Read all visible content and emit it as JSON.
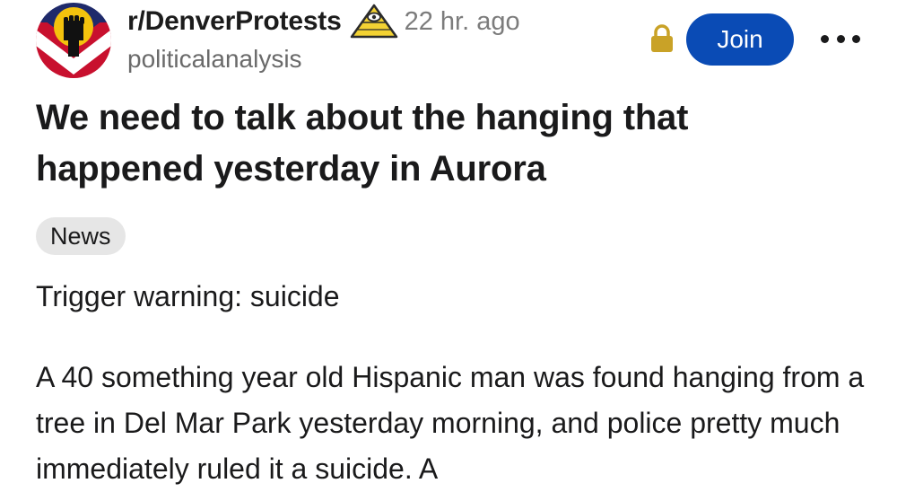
{
  "header": {
    "subreddit": "r/DenverProtests",
    "time_ago": "22 hr. ago",
    "username": "politicalanalysis",
    "join_label": "Join",
    "icons": {
      "avatar": "raised-fist-avatar",
      "award": "illuminati-pyramid-award-icon",
      "lock": "lock-icon",
      "more": "more-options-icon"
    }
  },
  "post": {
    "title": "We need to talk about the hanging that happened yesterday in Aurora",
    "flair": "News",
    "trigger_warning": "Trigger warning: suicide",
    "body": "A 40 something year old Hispanic man was found hanging from a tree in Del Mar Park yesterday morning, and police pretty much immediately ruled it a suicide. A"
  },
  "colors": {
    "join_bg": "#0a4bb5",
    "flair_bg": "#e6e6e6",
    "meta_gray": "#7c7c7c",
    "lock_gold": "#c9a227",
    "avatar_red": "#c8102e",
    "avatar_navy": "#1f2a6b",
    "avatar_yellow": "#f4c20d"
  }
}
